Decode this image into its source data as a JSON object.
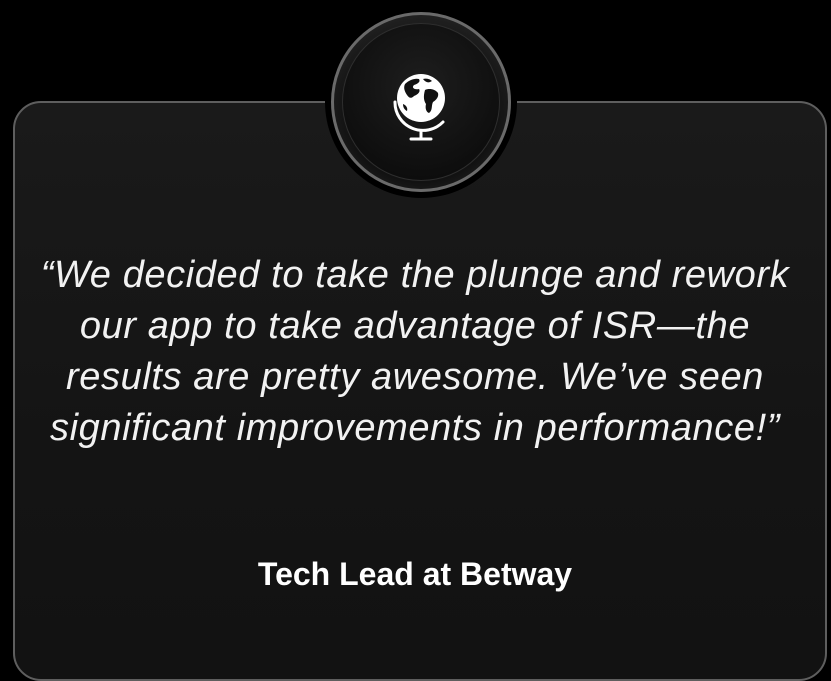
{
  "testimonial": {
    "quote": "“We decided to take the plunge and rework our app to take advantage of ISR—the results are pretty awesome. We’ve seen significant improvements in performance!”",
    "author": "Tech Lead at Betway",
    "icon": "globe-icon"
  },
  "colors": {
    "background": "#000000",
    "card": "#161616",
    "card_border": "#5e5e5e",
    "text": "#f2f2f2"
  }
}
